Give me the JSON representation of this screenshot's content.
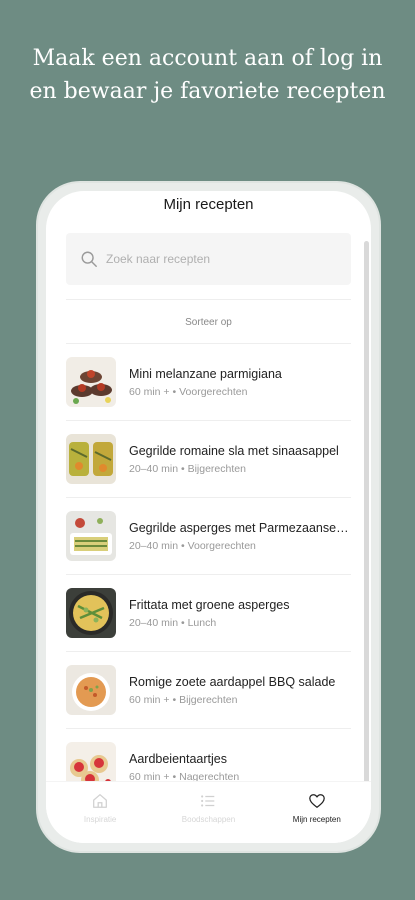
{
  "headline": "Maak een account aan of log in en bewaar je favoriete recepten",
  "screen": {
    "title": "Mijn recepten",
    "search": {
      "placeholder": "Zoek naar recepten",
      "icon": "search-icon"
    },
    "sort_label": "Sorteer op",
    "recipes": [
      {
        "name": "Mini melanzane parmigiana",
        "time": "60 min +",
        "category": "Voorgerechten"
      },
      {
        "name": "Gegrilde romaine sla met sinaasappel",
        "time": "20–40 min",
        "category": "Bijgerechten"
      },
      {
        "name": "Gegrilde asperges met Parmezaanse kaas",
        "time": "20–40 min",
        "category": "Voorgerechten"
      },
      {
        "name": "Frittata met groene asperges",
        "time": "20–40 min",
        "category": "Lunch"
      },
      {
        "name": "Romige zoete aardappel BBQ salade",
        "time": "60 min +",
        "category": "Bijgerechten"
      },
      {
        "name": "Aardbeientaartjes",
        "time": "60 min +",
        "category": "Nagerechten"
      }
    ],
    "separator": "•",
    "tabs": [
      {
        "label": "Inspiratie",
        "icon": "home-icon",
        "active": false
      },
      {
        "label": "Boodschappen",
        "icon": "list-icon",
        "active": false
      },
      {
        "label": "Mijn recepten",
        "icon": "heart-icon",
        "active": true
      }
    ]
  }
}
